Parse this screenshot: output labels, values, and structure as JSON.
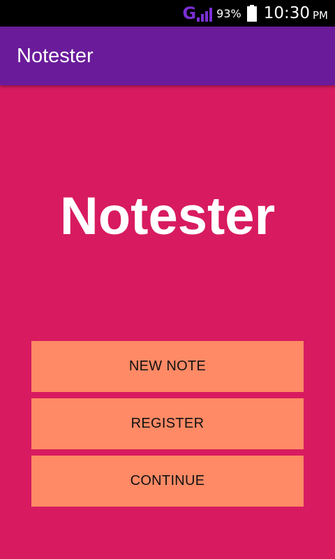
{
  "status_bar": {
    "network_label": "G",
    "battery_percent": "93%",
    "time": "10:30",
    "ampm": "PM",
    "network_color": "#7b2fd6"
  },
  "app_bar": {
    "title": "Notester",
    "color": "#6a1b9a"
  },
  "main": {
    "hero_title": "Notester",
    "background_color": "#d81b60",
    "buttons": [
      {
        "label": "NEW NOTE"
      },
      {
        "label": "REGISTER"
      },
      {
        "label": "CONTINUE"
      }
    ],
    "button_color": "#ff8a65"
  }
}
